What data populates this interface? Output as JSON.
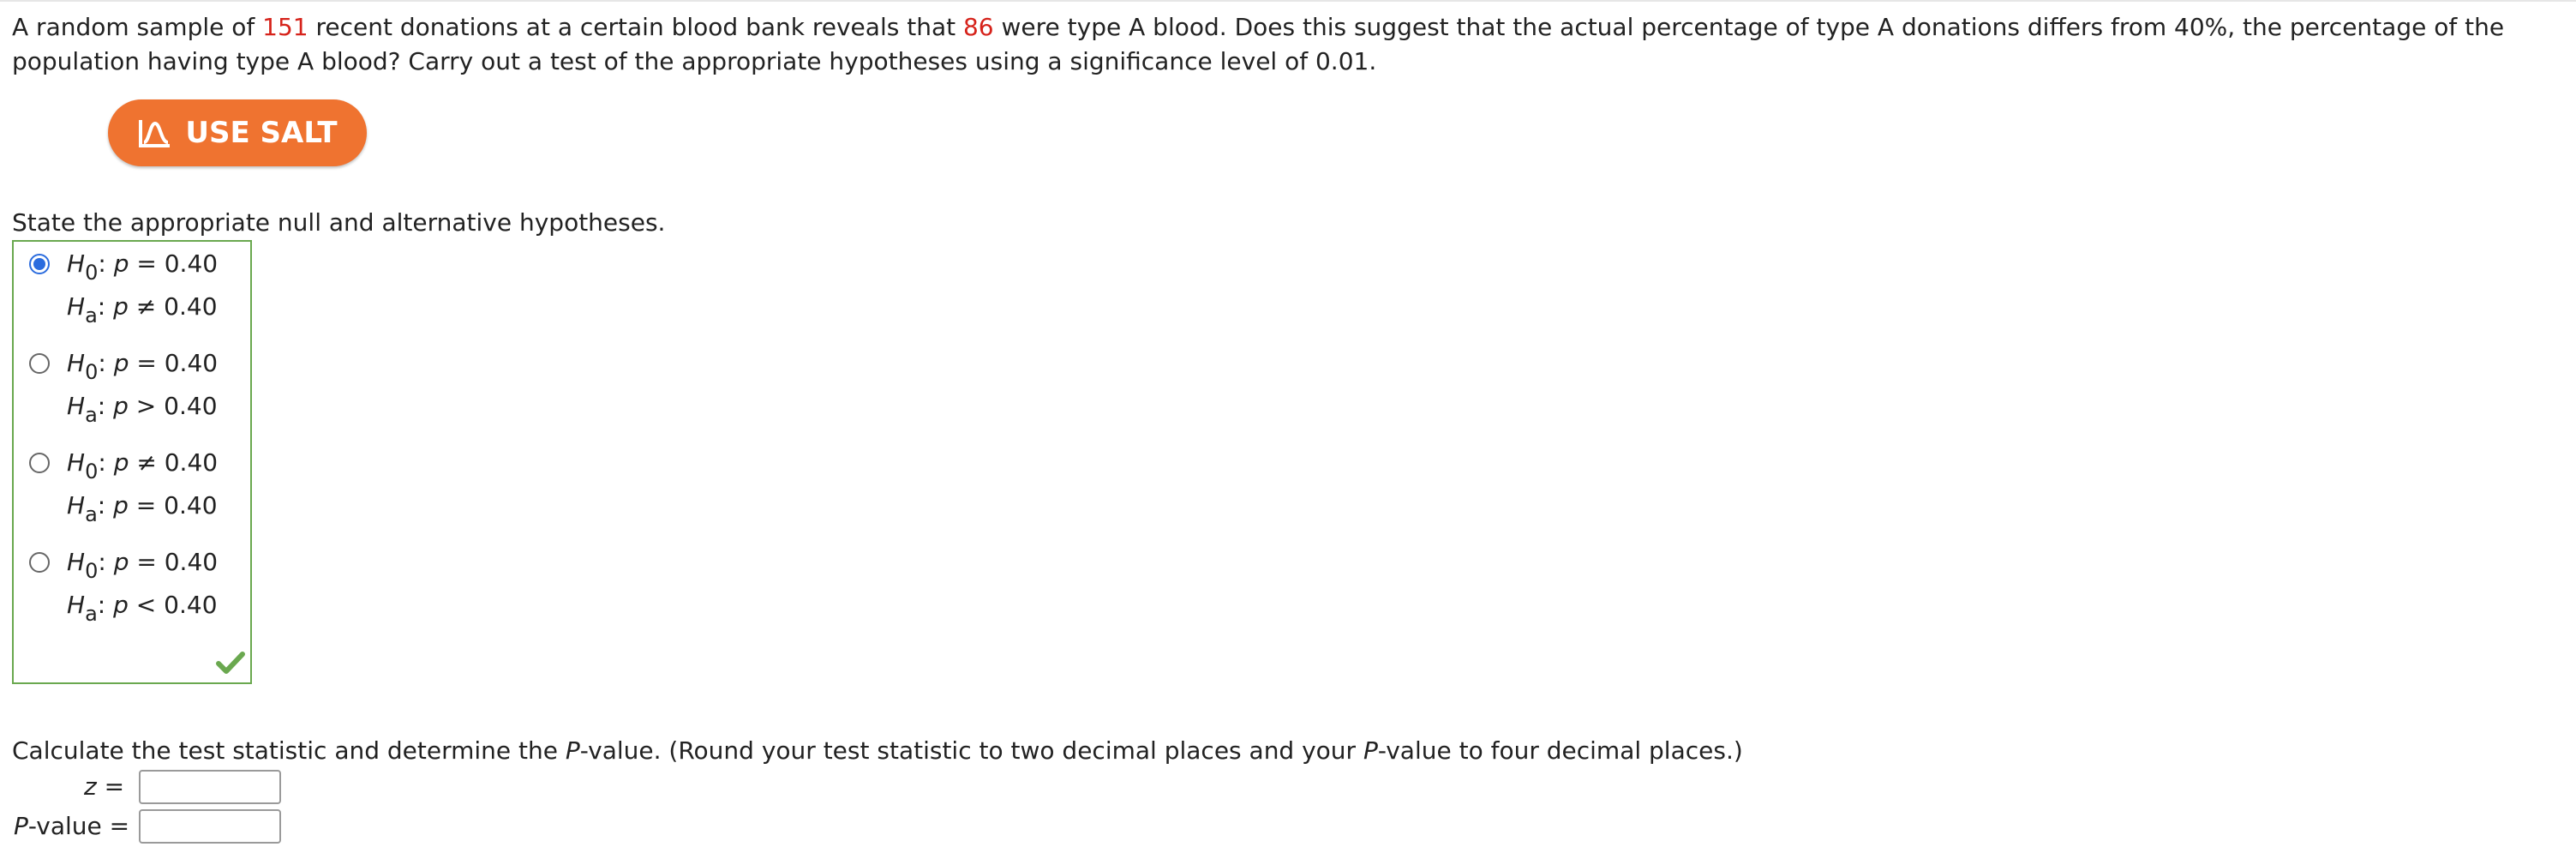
{
  "problem": {
    "part1": "A random sample of ",
    "n": "151",
    "part2": " recent donations at a certain blood bank reveals that ",
    "x": "86",
    "part3": " were type A blood. Does this suggest that the actual percentage of type A donations differs from 40%, the percentage of the population having type A blood? Carry out a test of the appropriate hypotheses using a significance level of 0.01."
  },
  "salt_button": {
    "label": "USE SALT"
  },
  "hypotheses_question": "State the appropriate null and alternative hypotheses.",
  "options": [
    {
      "selected": true,
      "h0": {
        "H": "H",
        "sub": "0",
        "rest": ": ",
        "p": "p",
        "rel": " = 0.40"
      },
      "ha": {
        "H": "H",
        "sub": "a",
        "rest": ": ",
        "p": "p",
        "rel": " ≠ 0.40"
      }
    },
    {
      "selected": false,
      "h0": {
        "H": "H",
        "sub": "0",
        "rest": ": ",
        "p": "p",
        "rel": " = 0.40"
      },
      "ha": {
        "H": "H",
        "sub": "a",
        "rest": ": ",
        "p": "p",
        "rel": " > 0.40"
      }
    },
    {
      "selected": false,
      "h0": {
        "H": "H",
        "sub": "0",
        "rest": ": ",
        "p": "p",
        "rel": " ≠ 0.40"
      },
      "ha": {
        "H": "H",
        "sub": "a",
        "rest": ": ",
        "p": "p",
        "rel": " = 0.40"
      }
    },
    {
      "selected": false,
      "h0": {
        "H": "H",
        "sub": "0",
        "rest": ": ",
        "p": "p",
        "rel": " = 0.40"
      },
      "ha": {
        "H": "H",
        "sub": "a",
        "rest": ": ",
        "p": "p",
        "rel": " < 0.40"
      }
    }
  ],
  "feedback_icon": "checkmark-icon",
  "calc_question": {
    "part1": "Calculate the test statistic and determine the ",
    "P1": "P",
    "part2": "-value. (Round your test statistic to two decimal places and your ",
    "P2": "P",
    "part3": "-value to four decimal places.)"
  },
  "z_label": {
    "var": "z",
    "eq": " ="
  },
  "pvalue_label": {
    "var": "P",
    "rest": "-value  ="
  },
  "z_input": {
    "value": ""
  },
  "pvalue_input": {
    "value": ""
  },
  "colors": {
    "accent": "#ef7330",
    "highlight": "#d6231b",
    "correct": "#6aa84f",
    "radio": "#2b6cde"
  }
}
